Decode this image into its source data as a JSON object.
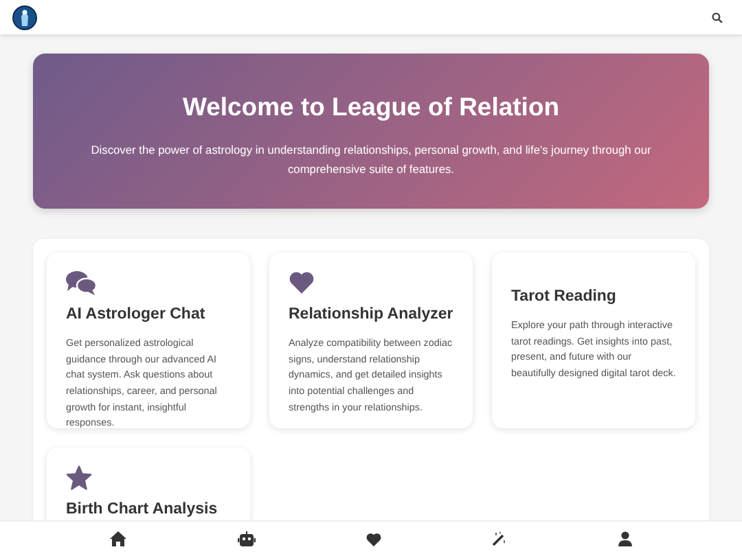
{
  "hero": {
    "title": "Welcome to League of Relation",
    "text": "Discover the power of astrology in understanding relationships, personal growth, and life's journey through our comprehensive suite of features."
  },
  "features": [
    {
      "kind": "chat",
      "title": "AI Astrologer Chat",
      "text": "Get personalized astrological guidance through our advanced AI chat system. Ask questions about relationships, career, and personal growth for instant, insightful responses."
    },
    {
      "kind": "heart",
      "title": "Relationship Analyzer",
      "text": "Analyze compatibility between zodiac signs, understand relationship dynamics, and get detailed insights into potential challenges and strengths in your relationships."
    },
    {
      "kind": "plain",
      "title": "Tarot Reading",
      "text": "Explore your path through interactive tarot readings. Get insights into past, present, and future with our beautifully designed digital tarot deck."
    },
    {
      "kind": "star",
      "title": "Birth Chart Analysis"
    }
  ]
}
